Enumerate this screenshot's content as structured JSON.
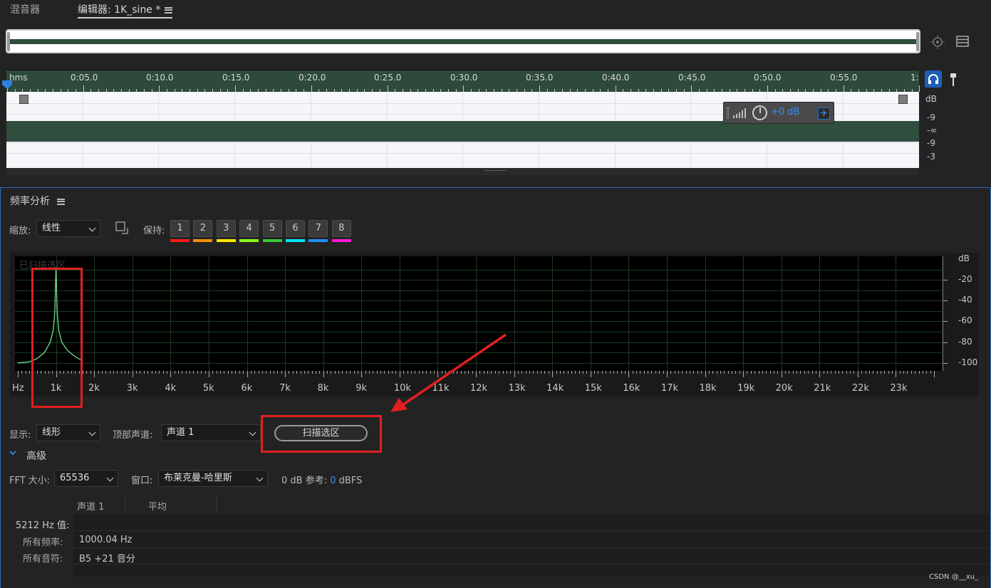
{
  "tabs": [
    {
      "label": "混音器"
    },
    {
      "label": "编辑器: 1K_sine *"
    }
  ],
  "timeline": {
    "ruler": [
      "hms",
      "0:05.0",
      "0:10.0",
      "0:15.0",
      "0:20.0",
      "0:25.0",
      "0:30.0",
      "0:35.0",
      "0:40.0",
      "0:45.0",
      "0:50.0",
      "0:55.0",
      "1:"
    ],
    "db_scale": [
      "dB",
      "-9",
      "-∞",
      "-9",
      "-3"
    ],
    "gain_hud": "+0 dB"
  },
  "panel": {
    "title": "频率分析",
    "zoom_label": "缩放:",
    "zoom_value": "线性",
    "hold_label": "保持:",
    "holds": [
      {
        "label": "1",
        "color": "#ff1a1a"
      },
      {
        "label": "2",
        "color": "#ff8c00"
      },
      {
        "label": "3",
        "color": "#ffe800"
      },
      {
        "label": "4",
        "color": "#8cff1a"
      },
      {
        "label": "5",
        "color": "#3cc43c"
      },
      {
        "label": "6",
        "color": "#00e5ff"
      },
      {
        "label": "7",
        "color": "#1e90ff"
      },
      {
        "label": "8",
        "color": "#ff1ad9"
      }
    ],
    "overlay_text": "已扫描选区",
    "display_label": "显示:",
    "display_value": "线形",
    "top_channel_label": "顶部声道:",
    "top_channel_value": "声道 1",
    "scan_button": "扫描选区",
    "advanced_label": "高级",
    "fft_label": "FFT 大小:",
    "fft_value": "65536",
    "window_label": "窗口:",
    "window_value": "布莱克曼-哈里斯",
    "ref_label": "0 dB 参考:",
    "ref_value": "0",
    "ref_unit": "dBFS",
    "table": {
      "headers": [
        "声道 1",
        "平均"
      ],
      "rows": [
        {
          "label": "5212 Hz 值:",
          "value": ""
        },
        {
          "label": "所有频率:",
          "value": "1000.04 Hz"
        },
        {
          "label": "所有音符:",
          "value": "B5 +21 音分"
        }
      ]
    },
    "watermark": "CSDN @__xu_"
  },
  "chart_data": {
    "type": "line",
    "title": "",
    "xlabel": "",
    "ylabel": "dB",
    "x_ticks": [
      "Hz",
      "1k",
      "2k",
      "3k",
      "4k",
      "5k",
      "6k",
      "7k",
      "8k",
      "9k",
      "10k",
      "11k",
      "12k",
      "13k",
      "14k",
      "15k",
      "16k",
      "17k",
      "18k",
      "19k",
      "20k",
      "21k",
      "22k",
      "23k"
    ],
    "y_ticks": [
      "dB",
      "-20",
      "-40",
      "-60",
      "-80",
      "-100"
    ],
    "xlim": [
      0,
      24000
    ],
    "ylim": [
      -105,
      0
    ],
    "series": [
      {
        "color": "#6de08a",
        "x": [
          0,
          300,
          500,
          700,
          850,
          930,
          970,
          1000,
          1030,
          1070,
          1150,
          1300,
          1500,
          1650
        ],
        "y": [
          -100,
          -99,
          -96,
          -90,
          -80,
          -68,
          -50,
          -8,
          -50,
          -68,
          -80,
          -88,
          -94,
          -97
        ]
      }
    ]
  }
}
